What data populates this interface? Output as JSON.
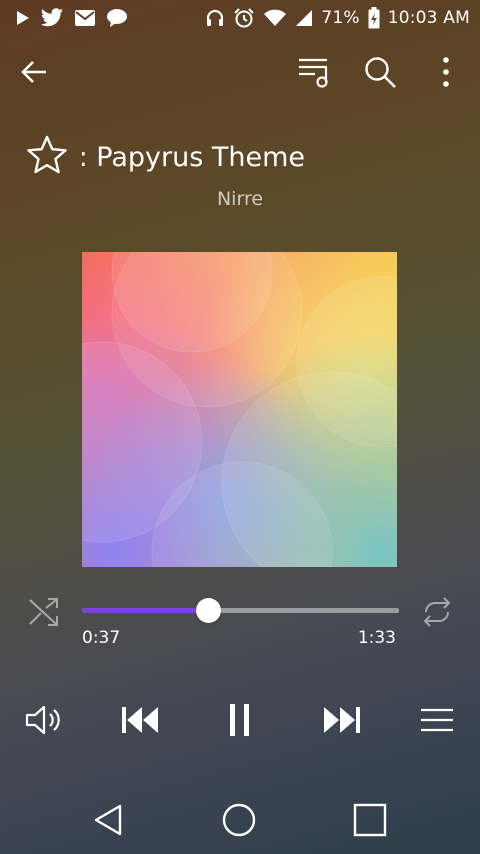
{
  "status_bar": {
    "left_icons": [
      "play-store-icon",
      "twitter-icon",
      "mail-icon",
      "chat-icon"
    ],
    "right_icons": [
      "headphones-icon",
      "alarm-icon",
      "wifi-icon",
      "signal-icon",
      "battery-charging-icon"
    ],
    "battery": "71%",
    "time": "10:03 AM"
  },
  "toolbar": {
    "back_icon": "arrow-left-icon",
    "queue_icon": "playlist-icon",
    "search_icon": "search-icon",
    "more_icon": "more-vert-icon"
  },
  "track": {
    "title": "Undertale: Papyrus Theme",
    "title_visible": "e: Papyrus Theme",
    "artist": "Nirre",
    "favorite": false
  },
  "playback": {
    "current_time": "0:37",
    "total_time": "1:33",
    "progress": 0.398,
    "shuffle": false,
    "repeat": false,
    "state": "playing"
  },
  "controls": {
    "volume_icon": "volume-icon",
    "previous_icon": "skip-previous-icon",
    "pause_icon": "pause-icon",
    "next_icon": "skip-next-icon",
    "playlist_icon": "menu-icon"
  },
  "nav_bar": {
    "back_icon": "nav-back-icon",
    "home_icon": "nav-home-icon",
    "recents_icon": "nav-recents-icon"
  },
  "colors": {
    "progress_accent": "#7a45d8",
    "track_color": "#9a9ca0"
  }
}
